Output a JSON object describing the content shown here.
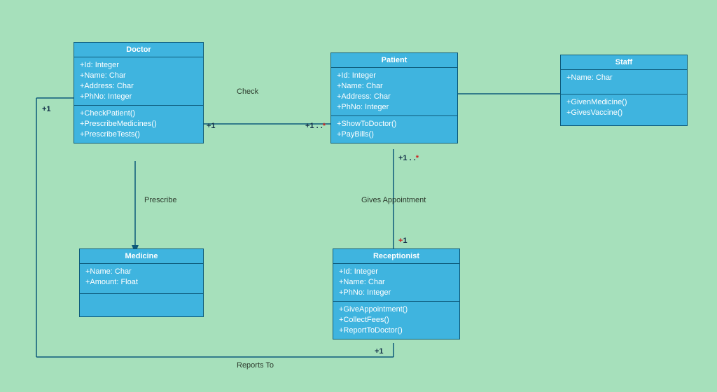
{
  "classes": {
    "doctor": {
      "title": "Doctor",
      "attrs": [
        "+Id: Integer",
        "+Name: Char",
        "+Address: Char",
        "+PhNo: Integer"
      ],
      "ops": [
        "+CheckPatient()",
        "+PrescribeMedicines()",
        "+PrescribeTests()"
      ]
    },
    "patient": {
      "title": "Patient",
      "attrs": [
        "+Id: Integer",
        "+Name: Char",
        "+Address: Char",
        "+PhNo: Integer"
      ],
      "ops": [
        "+ShowToDoctor()",
        "+PayBills()"
      ]
    },
    "staff": {
      "title": "Staff",
      "attrs": [
        "+Name: Char"
      ],
      "ops": [
        "+GivenMedicine()",
        "+GivesVaccine()"
      ]
    },
    "medicine": {
      "title": "Medicine",
      "attrs": [
        "+Name: Char",
        "+Amount: Float"
      ],
      "ops": []
    },
    "receptionist": {
      "title": "Receptionist",
      "attrs": [
        "+Id: Integer",
        "+Name: Char",
        "+PhNo: Integer"
      ],
      "ops": [
        "+GiveAppointment()",
        "+CollectFees()",
        "+ReportToDoctor()"
      ]
    }
  },
  "relations": {
    "check": {
      "label": "Check",
      "leftMult": "+1",
      "rightMult": "+1 . .*"
    },
    "prescribe": {
      "label": "Prescribe"
    },
    "givesAppointment": {
      "label": "Gives Appointment",
      "topMult": "+1 . .*",
      "bottomMult": "+1"
    },
    "reportsTo": {
      "label": "Reports To",
      "leftMult": "+1",
      "rightMult": "+1"
    },
    "patientStaff": {}
  }
}
